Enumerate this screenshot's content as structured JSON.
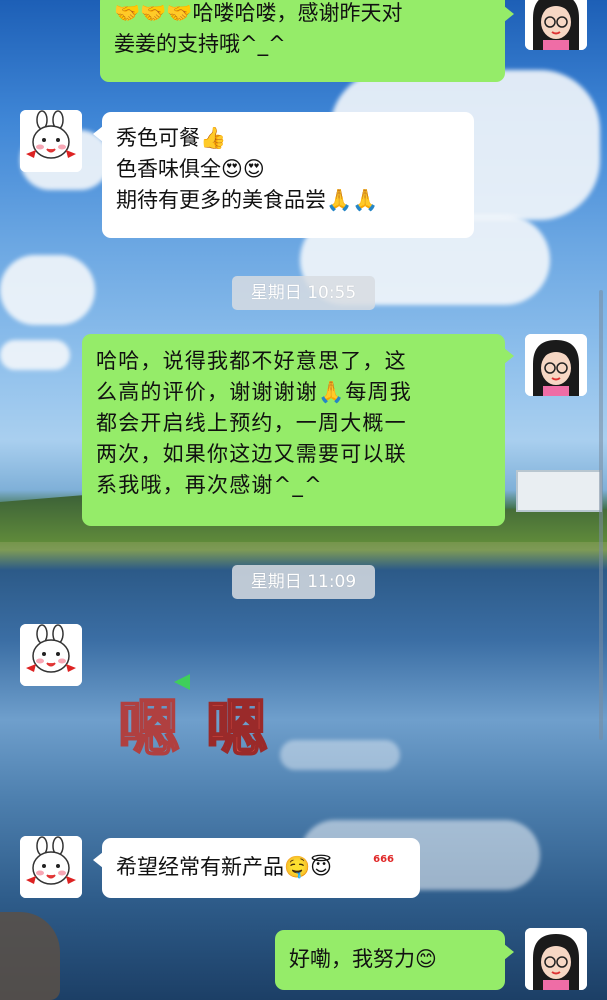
{
  "messages": [
    {
      "from": "me",
      "lines": [
        "🤝🤝🤝哈喽哈喽，感谢昨天对",
        "姜姜的支持哦^_^"
      ]
    },
    {
      "from": "other",
      "lines": [
        "秀色可餐👍",
        "色香味俱全😍😍",
        "期待有更多的美食品尝🙏🙏"
      ]
    },
    {
      "from": "me",
      "lines": [
        "哈哈，说得我都不好意思了，这",
        "么高的评价，谢谢谢谢🙏每周我",
        "都会开启线上预约，一周大概一",
        "两次，如果你这边又需要可以联",
        "系我哦，再次感谢^_^"
      ]
    },
    {
      "from": "other",
      "sticker": [
        "嗯",
        "嗯"
      ]
    },
    {
      "from": "other",
      "lines": [
        "希望经常有新产品🤤😇"
      ]
    },
    {
      "from": "me",
      "lines": [
        "好嘞，我努力😊"
      ]
    }
  ],
  "timestamps": [
    "星期日 10:55",
    "星期日 11:09"
  ],
  "sticker_badge": "666",
  "avatars": {
    "me": "girl-with-glasses-avatar",
    "other": "cartoon-rabbit-avatar"
  },
  "colors": {
    "me_bubble": "#95ec69",
    "other_bubble": "#ffffff",
    "timestamp_bg": "#d7dce2"
  }
}
